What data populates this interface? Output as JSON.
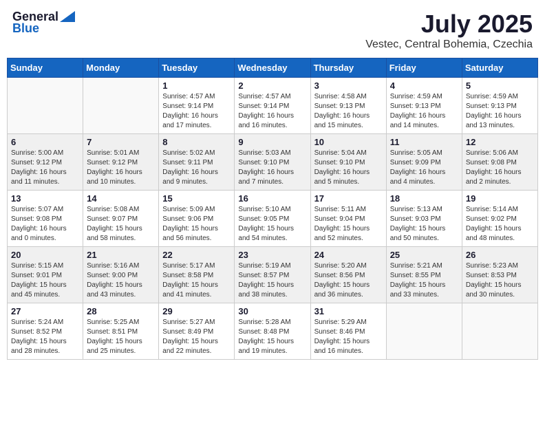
{
  "header": {
    "logo_general": "General",
    "logo_blue": "Blue",
    "main_title": "July 2025",
    "subtitle": "Vestec, Central Bohemia, Czechia"
  },
  "calendar": {
    "days_of_week": [
      "Sunday",
      "Monday",
      "Tuesday",
      "Wednesday",
      "Thursday",
      "Friday",
      "Saturday"
    ],
    "weeks": [
      {
        "shaded": false,
        "days": [
          {
            "num": "",
            "info": ""
          },
          {
            "num": "",
            "info": ""
          },
          {
            "num": "1",
            "info": "Sunrise: 4:57 AM\nSunset: 9:14 PM\nDaylight: 16 hours\nand 17 minutes."
          },
          {
            "num": "2",
            "info": "Sunrise: 4:57 AM\nSunset: 9:14 PM\nDaylight: 16 hours\nand 16 minutes."
          },
          {
            "num": "3",
            "info": "Sunrise: 4:58 AM\nSunset: 9:13 PM\nDaylight: 16 hours\nand 15 minutes."
          },
          {
            "num": "4",
            "info": "Sunrise: 4:59 AM\nSunset: 9:13 PM\nDaylight: 16 hours\nand 14 minutes."
          },
          {
            "num": "5",
            "info": "Sunrise: 4:59 AM\nSunset: 9:13 PM\nDaylight: 16 hours\nand 13 minutes."
          }
        ]
      },
      {
        "shaded": true,
        "days": [
          {
            "num": "6",
            "info": "Sunrise: 5:00 AM\nSunset: 9:12 PM\nDaylight: 16 hours\nand 11 minutes."
          },
          {
            "num": "7",
            "info": "Sunrise: 5:01 AM\nSunset: 9:12 PM\nDaylight: 16 hours\nand 10 minutes."
          },
          {
            "num": "8",
            "info": "Sunrise: 5:02 AM\nSunset: 9:11 PM\nDaylight: 16 hours\nand 9 minutes."
          },
          {
            "num": "9",
            "info": "Sunrise: 5:03 AM\nSunset: 9:10 PM\nDaylight: 16 hours\nand 7 minutes."
          },
          {
            "num": "10",
            "info": "Sunrise: 5:04 AM\nSunset: 9:10 PM\nDaylight: 16 hours\nand 5 minutes."
          },
          {
            "num": "11",
            "info": "Sunrise: 5:05 AM\nSunset: 9:09 PM\nDaylight: 16 hours\nand 4 minutes."
          },
          {
            "num": "12",
            "info": "Sunrise: 5:06 AM\nSunset: 9:08 PM\nDaylight: 16 hours\nand 2 minutes."
          }
        ]
      },
      {
        "shaded": false,
        "days": [
          {
            "num": "13",
            "info": "Sunrise: 5:07 AM\nSunset: 9:08 PM\nDaylight: 16 hours\nand 0 minutes."
          },
          {
            "num": "14",
            "info": "Sunrise: 5:08 AM\nSunset: 9:07 PM\nDaylight: 15 hours\nand 58 minutes."
          },
          {
            "num": "15",
            "info": "Sunrise: 5:09 AM\nSunset: 9:06 PM\nDaylight: 15 hours\nand 56 minutes."
          },
          {
            "num": "16",
            "info": "Sunrise: 5:10 AM\nSunset: 9:05 PM\nDaylight: 15 hours\nand 54 minutes."
          },
          {
            "num": "17",
            "info": "Sunrise: 5:11 AM\nSunset: 9:04 PM\nDaylight: 15 hours\nand 52 minutes."
          },
          {
            "num": "18",
            "info": "Sunrise: 5:13 AM\nSunset: 9:03 PM\nDaylight: 15 hours\nand 50 minutes."
          },
          {
            "num": "19",
            "info": "Sunrise: 5:14 AM\nSunset: 9:02 PM\nDaylight: 15 hours\nand 48 minutes."
          }
        ]
      },
      {
        "shaded": true,
        "days": [
          {
            "num": "20",
            "info": "Sunrise: 5:15 AM\nSunset: 9:01 PM\nDaylight: 15 hours\nand 45 minutes."
          },
          {
            "num": "21",
            "info": "Sunrise: 5:16 AM\nSunset: 9:00 PM\nDaylight: 15 hours\nand 43 minutes."
          },
          {
            "num": "22",
            "info": "Sunrise: 5:17 AM\nSunset: 8:58 PM\nDaylight: 15 hours\nand 41 minutes."
          },
          {
            "num": "23",
            "info": "Sunrise: 5:19 AM\nSunset: 8:57 PM\nDaylight: 15 hours\nand 38 minutes."
          },
          {
            "num": "24",
            "info": "Sunrise: 5:20 AM\nSunset: 8:56 PM\nDaylight: 15 hours\nand 36 minutes."
          },
          {
            "num": "25",
            "info": "Sunrise: 5:21 AM\nSunset: 8:55 PM\nDaylight: 15 hours\nand 33 minutes."
          },
          {
            "num": "26",
            "info": "Sunrise: 5:23 AM\nSunset: 8:53 PM\nDaylight: 15 hours\nand 30 minutes."
          }
        ]
      },
      {
        "shaded": false,
        "days": [
          {
            "num": "27",
            "info": "Sunrise: 5:24 AM\nSunset: 8:52 PM\nDaylight: 15 hours\nand 28 minutes."
          },
          {
            "num": "28",
            "info": "Sunrise: 5:25 AM\nSunset: 8:51 PM\nDaylight: 15 hours\nand 25 minutes."
          },
          {
            "num": "29",
            "info": "Sunrise: 5:27 AM\nSunset: 8:49 PM\nDaylight: 15 hours\nand 22 minutes."
          },
          {
            "num": "30",
            "info": "Sunrise: 5:28 AM\nSunset: 8:48 PM\nDaylight: 15 hours\nand 19 minutes."
          },
          {
            "num": "31",
            "info": "Sunrise: 5:29 AM\nSunset: 8:46 PM\nDaylight: 15 hours\nand 16 minutes."
          },
          {
            "num": "",
            "info": ""
          },
          {
            "num": "",
            "info": ""
          }
        ]
      }
    ]
  }
}
